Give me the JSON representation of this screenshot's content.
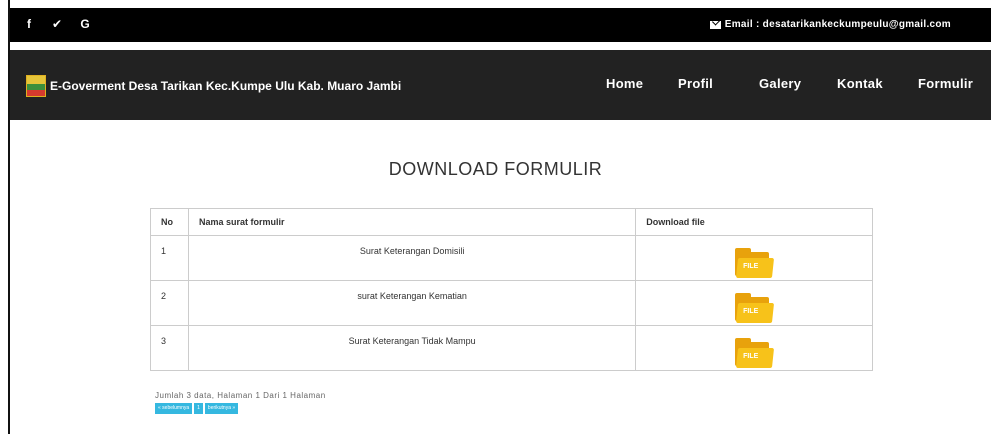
{
  "topbar": {
    "social": [
      {
        "icon": "facebook-icon",
        "glyph": "f"
      },
      {
        "icon": "twitter-icon",
        "glyph": "✔"
      },
      {
        "icon": "google-icon",
        "glyph": "G"
      }
    ],
    "email": "Email : desatarikankeckumpeulu@gmail.com"
  },
  "navbar": {
    "brand": "E-Goverment Desa Tarikan Kec.Kumpe Ulu Kab. Muaro Jambi",
    "menu": [
      "Home",
      "Profil",
      "Galery",
      "Kontak",
      "Formulir"
    ]
  },
  "main": {
    "heading": "DOWNLOAD FORMULIR",
    "table": {
      "headers": [
        "No",
        "Nama surat formulir",
        "Download file"
      ],
      "rows": [
        {
          "no": "1",
          "name": "Surat Keterangan Domisili",
          "file": "FILE"
        },
        {
          "no": "2",
          "name": "surat Keterangan Kematian",
          "file": "FILE"
        },
        {
          "no": "3",
          "name": "Surat Keterangan Tidak Mampu",
          "file": "FILE"
        }
      ]
    },
    "page_info": "Jumlah 3 data, Halaman 1 Dari 1 Halaman",
    "pager": {
      "prev": "« sebelumnya",
      "current": "1",
      "next": "berikutnya »"
    }
  },
  "colors": {
    "topbar": "#000000",
    "navbar": "#222222",
    "pager": "#35b8e0",
    "folder": "#f7c21a"
  }
}
